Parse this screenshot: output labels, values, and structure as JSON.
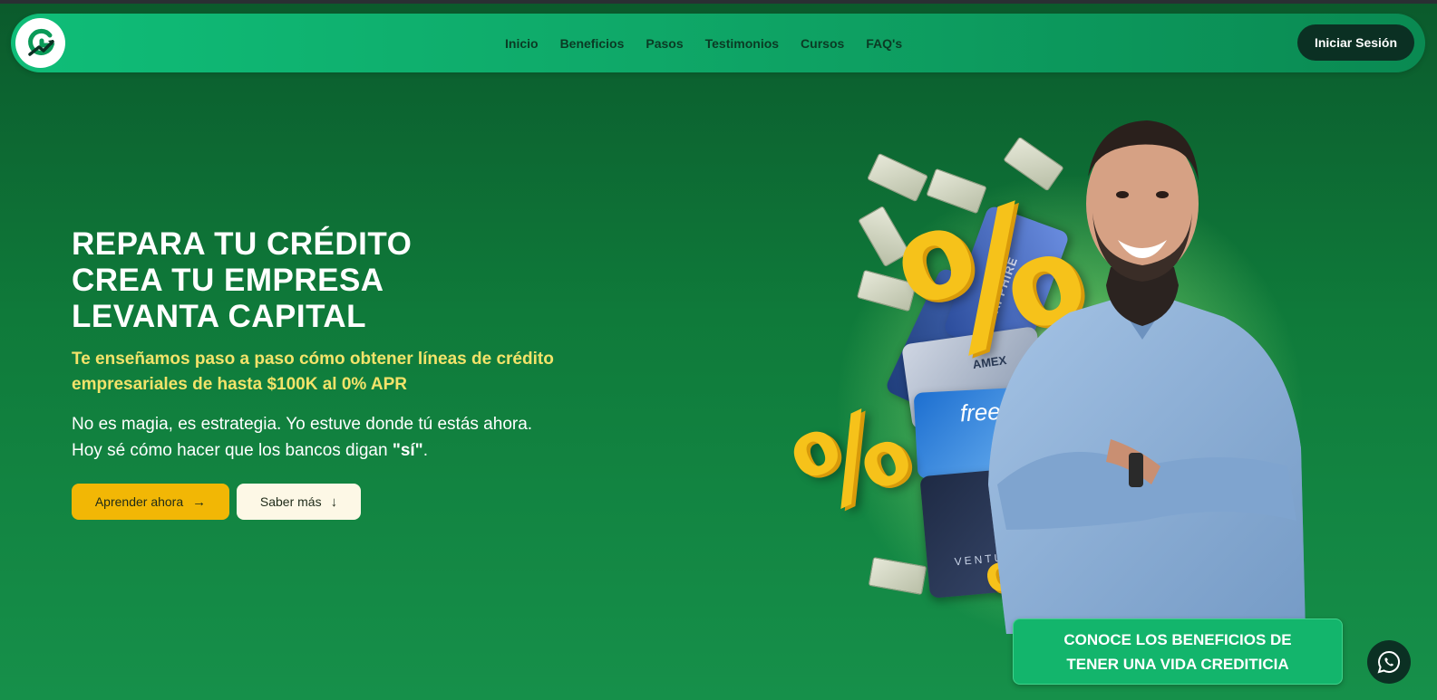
{
  "nav": {
    "logo_icon": "growth-g-logo-icon",
    "links": [
      "Inicio",
      "Beneficios",
      "Pasos",
      "Testimonios",
      "Cursos",
      "FAQ's"
    ],
    "login_label": "Iniciar Sesión"
  },
  "hero": {
    "title_lines": [
      "REPARA TU CRÉDITO",
      "CREA TU EMPRESA",
      "LEVANTA CAPITAL"
    ],
    "subtitle_lines": [
      "Te enseñamos paso a paso cómo obtener líneas de crédito",
      "empresariales de hasta $100K al 0% APR"
    ],
    "desc_line1": "No es magia, es estrategia. Yo estuve donde tú estás ahora.",
    "desc_line2_prefix": "Hoy sé cómo hacer que los bancos digan ",
    "desc_line2_bold": "\"sí\"",
    "desc_line2_suffix": ".",
    "primary_button": "Aprender ahora",
    "primary_button_icon": "arrow-right-icon",
    "secondary_button": "Saber más",
    "secondary_button_icon": "arrow-down-icon"
  },
  "illustration": {
    "percent_symbol": "%",
    "card_texts": [
      "frees",
      "AMEX",
      "SAPPHIRE",
      "VENTURE"
    ]
  },
  "cta": {
    "line1": "CONOCE LOS BENEFICIOS DE",
    "line2": "TENER UNA VIDA CREDITICIA"
  },
  "floating": {
    "whatsapp_icon": "whatsapp-icon"
  },
  "colors": {
    "background": "#0f7a3a",
    "accent_yellow": "#f2b705",
    "subtitle_yellow": "#f3e36a",
    "dark_button": "#0b3023",
    "nav_green": "#0fbd78"
  }
}
